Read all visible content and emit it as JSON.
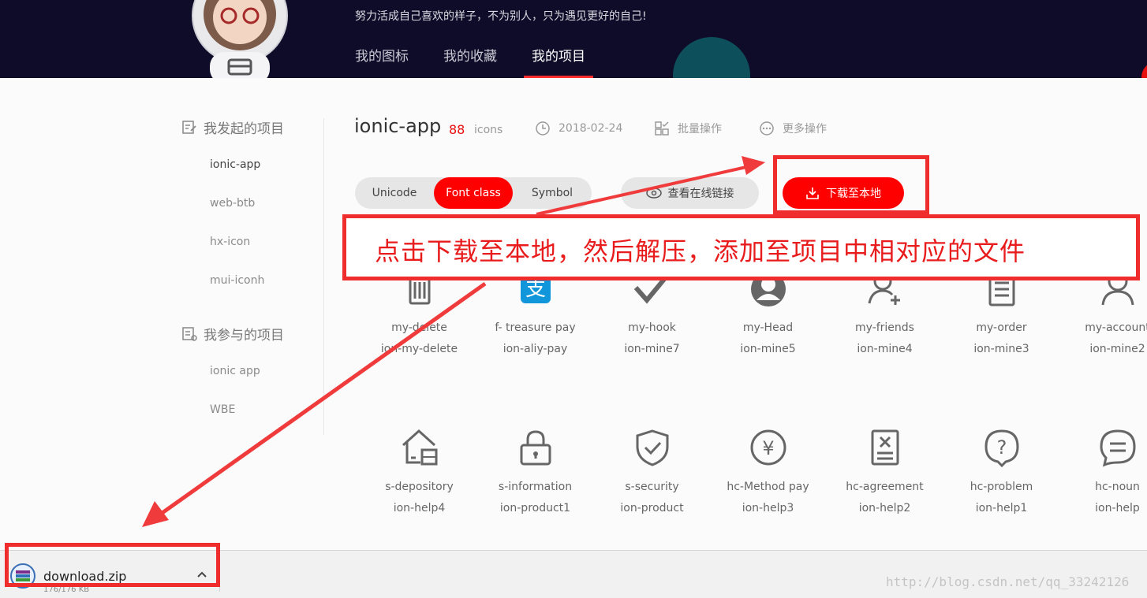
{
  "header": {
    "slogan": "努力活成自己喜欢的样子，不为别人，只为遇见更好的自己!",
    "nav": [
      {
        "label": "我的图标"
      },
      {
        "label": "我的收藏"
      },
      {
        "label": "我的项目"
      }
    ],
    "active_nav": "我的项目"
  },
  "sidebar": {
    "initiated_title": "我发起的项目",
    "initiated_items": [
      "ionic-app",
      "web-btb",
      "hx-icon",
      "mui-iconh"
    ],
    "participated_title": "我参与的项目",
    "participated_items": [
      "ionic app",
      "WBE"
    ]
  },
  "project": {
    "title": "ionic-app",
    "count": "88",
    "count_unit": "icons",
    "date": "2018-02-24",
    "batch_label": "批量操作",
    "more_label": "更多操作"
  },
  "toolbar": {
    "tabs": [
      "Unicode",
      "Font class",
      "Symbol"
    ],
    "active_tab": "Font class",
    "online_link_label": "查看在线链接",
    "download_label": "下载至本地"
  },
  "annotation": {
    "text": "点击下载至本地，然后解压，添加至项目中相对应的文件"
  },
  "icons": [
    {
      "name": "my-delete",
      "code": "ion-my-delete",
      "icon": "trash-icon"
    },
    {
      "name": "f- treasure pay",
      "code": "ion-aliy-pay",
      "icon": "alipay-icon"
    },
    {
      "name": "my-hook",
      "code": "ion-mine7",
      "icon": "checkmark-icon"
    },
    {
      "name": "my-Head",
      "code": "ion-mine5",
      "icon": "avatar-circle-icon"
    },
    {
      "name": "my-friends",
      "code": "ion-mine4",
      "icon": "add-user-icon"
    },
    {
      "name": "my-order",
      "code": "ion-mine3",
      "icon": "clipboard-icon"
    },
    {
      "name": "my-account",
      "code": "ion-mine2",
      "icon": "user-icon"
    },
    {
      "name": "s-depository",
      "code": "ion-help4",
      "icon": "warehouse-icon"
    },
    {
      "name": "s-information",
      "code": "ion-product1",
      "icon": "lock-icon"
    },
    {
      "name": "s-security",
      "code": "ion-product",
      "icon": "shield-check-icon"
    },
    {
      "name": "hc-Method pay",
      "code": "ion-help3",
      "icon": "yen-circle-icon"
    },
    {
      "name": "hc-agreement",
      "code": "ion-help2",
      "icon": "document-x-icon"
    },
    {
      "name": "hc-problem",
      "code": "ion-help1",
      "icon": "question-bubble-icon"
    },
    {
      "name": "hc-noun",
      "code": "ion-help",
      "icon": "chat-lines-icon"
    }
  ],
  "download_bar": {
    "file_name": "download.zip",
    "progress": "176/176 KB"
  },
  "watermark": "http://blog.csdn.net/qq_33242126",
  "colors": {
    "header_bg": "#0f0c29",
    "accent_red": "#ff0000",
    "annotation_red": "#ef2d2d"
  }
}
